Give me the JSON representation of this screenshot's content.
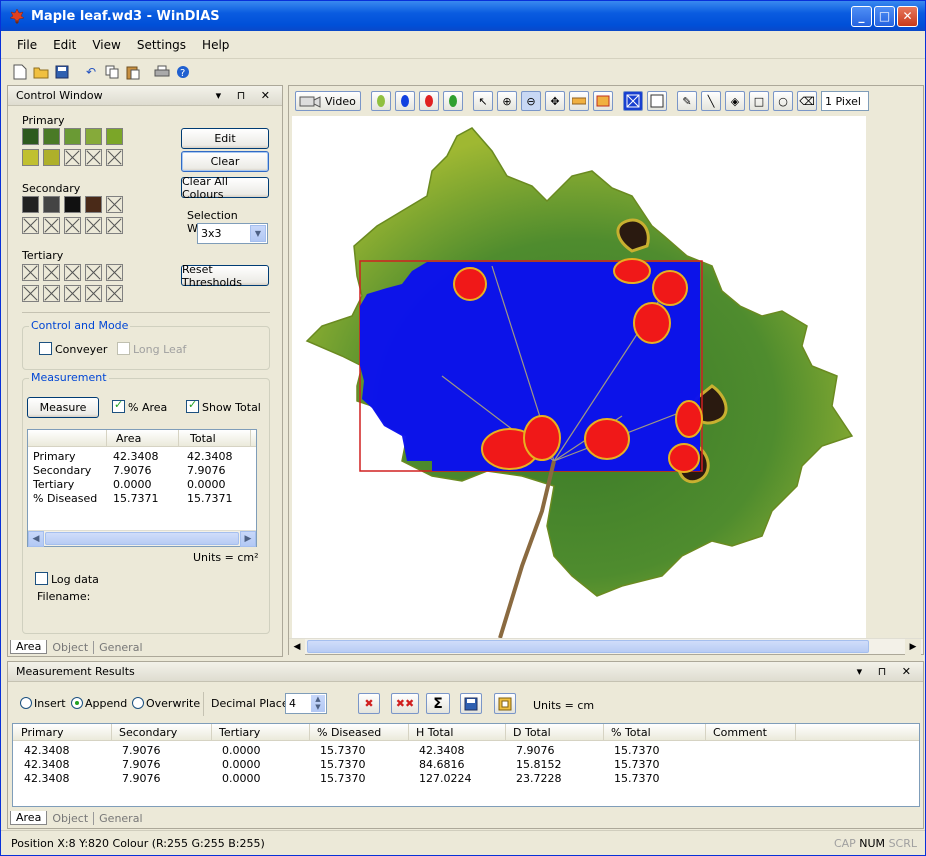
{
  "window": {
    "title": "Maple leaf.wd3 - WinDIAS",
    "minimize": "_",
    "maximize": "□",
    "close": "✕"
  },
  "menu": [
    "File",
    "Edit",
    "View",
    "Settings",
    "Help"
  ],
  "control_window": {
    "title": "Control Window",
    "primary_label": "Primary",
    "secondary_label": "Secondary",
    "tertiary_label": "Tertiary",
    "primary_colors": [
      "#2d5a1e",
      "#4a7a26",
      "#6a9a34",
      "#86aa3a",
      "#7ba628",
      "#c0c030",
      "#aeb02a"
    ],
    "secondary_colors": [
      "#222222",
      "#444444",
      "#111111",
      "#4a2a18"
    ],
    "edit_button": "Edit",
    "clear_button": "Clear",
    "clear_all_button": "Clear All Colours",
    "selection_window_label": "Selection Window",
    "selection_window_value": "3x3",
    "reset_thresholds_button": "Reset Thresholds",
    "control_and_mode": {
      "title": "Control and Mode",
      "conveyer": "Conveyer",
      "long_leaf": "Long Leaf"
    },
    "measurement": {
      "title": "Measurement",
      "measure_button": "Measure",
      "percent_area": "% Area",
      "show_total": "Show Total",
      "columns": [
        "",
        "Area",
        "Total"
      ],
      "rows": [
        [
          "Primary",
          "42.3408",
          "42.3408"
        ],
        [
          "Secondary",
          "7.9076",
          "7.9076"
        ],
        [
          "Tertiary",
          "0.0000",
          "0.0000"
        ],
        [
          "% Diseased",
          "15.7371",
          "15.7371"
        ]
      ],
      "units": "Units = cm²",
      "log_data": "Log data",
      "filename_label": "Filename:"
    },
    "tabs": [
      "Area",
      "Object",
      "General"
    ]
  },
  "image_toolbar": {
    "video_label": "Video",
    "pen_size": "1 Pixel"
  },
  "results": {
    "title": "Measurement Results",
    "insert": "Insert",
    "append": "Append",
    "overwrite": "Overwrite",
    "decimal_places_label": "Decimal Places",
    "decimal_places_value": "4",
    "units": "Units = cm",
    "columns": [
      "Primary",
      "Secondary",
      "Tertiary",
      "% Diseased",
      "H Total",
      "D Total",
      "% Total",
      "Comment"
    ],
    "rows": [
      [
        "42.3408",
        "7.9076",
        "0.0000",
        "15.7370",
        "42.3408",
        "7.9076",
        "15.7370",
        ""
      ],
      [
        "42.3408",
        "7.9076",
        "0.0000",
        "15.7370",
        "84.6816",
        "15.8152",
        "15.7370",
        ""
      ],
      [
        "42.3408",
        "7.9076",
        "0.0000",
        "15.7370",
        "127.0224",
        "23.7228",
        "15.7370",
        ""
      ]
    ],
    "tabs": [
      "Area",
      "Object",
      "General"
    ]
  },
  "status": {
    "position": "Position  X:8 Y:820  Colour (R:255 G:255 B:255)",
    "cap": "CAP",
    "num": "NUM",
    "scrl": "SCRL"
  }
}
